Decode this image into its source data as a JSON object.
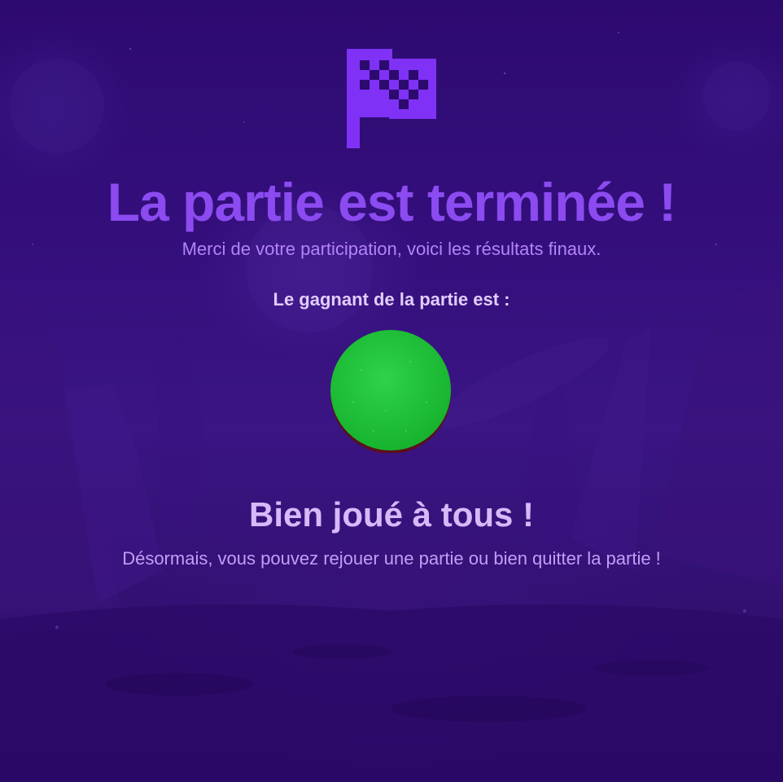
{
  "screen": {
    "icon": "checkered-flag-icon",
    "title": "La partie est terminée !",
    "subtitle": "Merci de votre participation, voici les résultats finaux.",
    "winner_label": "Le gagnant de la partie est :",
    "winner_token_color": "#1fbf38",
    "congrats": "Bien joué à tous !",
    "message": "Désormais, vous pouvez rejouer une partie ou bien quitter la partie !"
  },
  "colors": {
    "background": "#2c0a6e",
    "accent": "#8b4bf0",
    "subtitle": "#b384f5",
    "winner_label": "#e1cdfb",
    "congrats": "#d7b9fa"
  }
}
